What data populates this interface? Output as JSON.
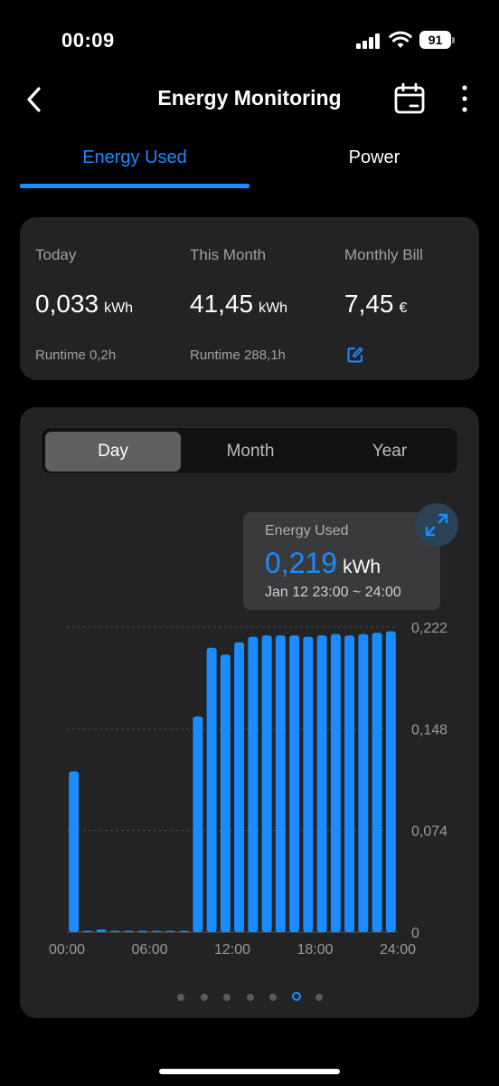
{
  "status_bar": {
    "time": "00:09",
    "battery": "91"
  },
  "nav": {
    "title": "Energy Monitoring"
  },
  "tabs": [
    {
      "label": "Energy Used",
      "active": true
    },
    {
      "label": "Power",
      "active": false
    }
  ],
  "summary": {
    "today": {
      "label": "Today",
      "value": "0,033",
      "unit": "kWh",
      "sub": "Runtime 0,2h"
    },
    "month": {
      "label": "This Month",
      "value": "41,45",
      "unit": "kWh",
      "sub": "Runtime 288,1h"
    },
    "bill": {
      "label": "Monthly Bill",
      "value": "7,45",
      "unit": "€"
    }
  },
  "period_selector": {
    "day": "Day",
    "month": "Month",
    "year": "Year",
    "selected": "Day"
  },
  "tooltip": {
    "label": "Energy Used",
    "value": "0,219",
    "unit": "kWh",
    "range": "Jan 12 23:00 ~ 24:00"
  },
  "colors": {
    "accent": "#1a8cff",
    "card": "#232325",
    "background": "#000000"
  },
  "pager": {
    "count": 7,
    "active_index": 5
  },
  "chart_data": {
    "type": "bar",
    "x_tick_labels": [
      "00:00",
      "06:00",
      "12:00",
      "18:00",
      "24:00"
    ],
    "y_tick_labels": [
      "0",
      "0,074",
      "0,148",
      "0,222"
    ],
    "ylim": [
      0,
      0.222
    ],
    "y_axis_position": "right",
    "grid": true,
    "categories": [
      "00",
      "01",
      "02",
      "03",
      "04",
      "05",
      "06",
      "07",
      "08",
      "09",
      "10",
      "11",
      "12",
      "13",
      "14",
      "15",
      "16",
      "17",
      "18",
      "19",
      "20",
      "21",
      "22",
      "23"
    ],
    "values": [
      0.117,
      0.001,
      0.002,
      0.001,
      0.001,
      0.001,
      0.001,
      0.001,
      0.001,
      0.157,
      0.207,
      0.202,
      0.211,
      0.215,
      0.216,
      0.216,
      0.216,
      0.215,
      0.216,
      0.217,
      0.216,
      0.217,
      0.218,
      0.219
    ]
  }
}
